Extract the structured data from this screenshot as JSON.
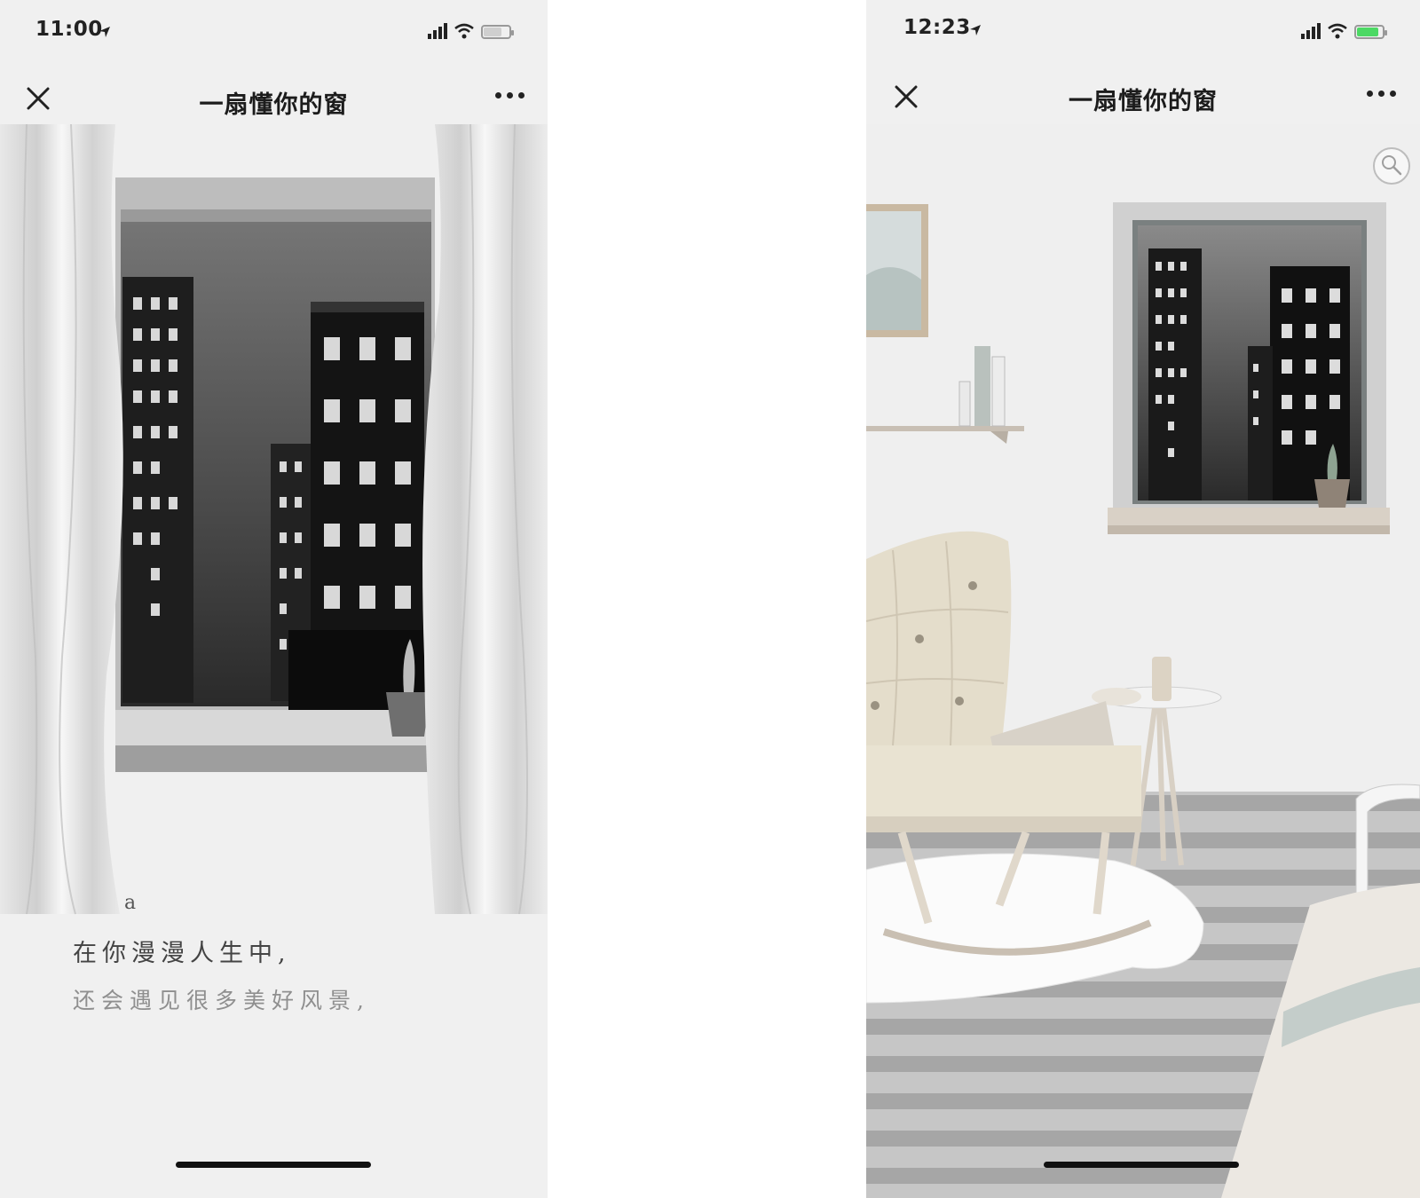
{
  "screens": [
    {
      "status": {
        "time": "11:00",
        "location_icon": "location-arrow-icon",
        "signal_icon": "signal-bars-icon",
        "wifi_icon": "wifi-icon",
        "battery_icon": "battery-charging-icon"
      },
      "nav": {
        "title": "一扇懂你的窗",
        "close_icon": "close-icon",
        "more_icon": "more-icon"
      },
      "text_lines": [
        "a",
        "在你漫漫人生中,",
        "还会遇见很多美好风景,"
      ]
    },
    {
      "status": {
        "time": "12:23",
        "location_icon": "location-arrow-icon",
        "signal_icon": "signal-bars-icon",
        "wifi_icon": "wifi-icon",
        "battery_icon": "battery-charging-icon"
      },
      "nav": {
        "title": "一扇懂你的窗",
        "close_icon": "close-icon",
        "more_icon": "more-icon"
      },
      "action_icon": "magnifier-icon"
    }
  ],
  "colors": {
    "battery_left": "#cfcfcf",
    "battery_right": "#4cd964",
    "wall": "#efefef",
    "floor_stripe": "#a8a8a8",
    "chair": "#e4ddcb"
  }
}
